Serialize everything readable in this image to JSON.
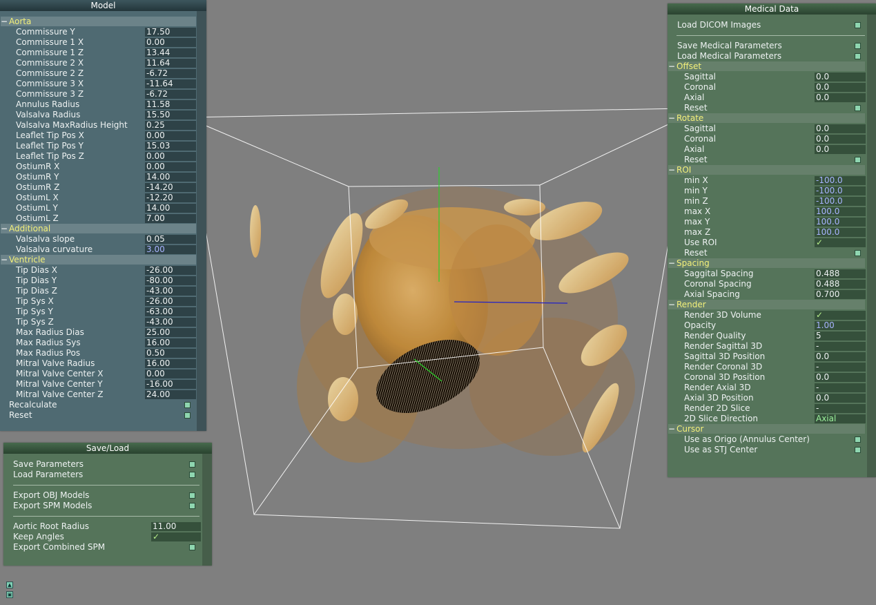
{
  "model": {
    "title": "Model",
    "sections": [
      {
        "name": "Aorta",
        "rows": [
          {
            "label": "Commissure Y",
            "value": "17.50"
          },
          {
            "label": "Commissure 1 X",
            "value": "0.00"
          },
          {
            "label": "Commissure 1 Z",
            "value": "13.44"
          },
          {
            "label": "Commissure 2 X",
            "value": "11.64"
          },
          {
            "label": "Commissure 2 Z",
            "value": "-6.72"
          },
          {
            "label": "Commissure 3 X",
            "value": "-11.64"
          },
          {
            "label": "Commissure 3 Z",
            "value": "-6.72"
          },
          {
            "label": "Annulus Radius",
            "value": "11.58"
          },
          {
            "label": "Valsalva Radius",
            "value": "15.50"
          },
          {
            "label": "Valsalva MaxRadius Height",
            "value": "0.25"
          },
          {
            "label": "Leaflet Tip Pos X",
            "value": "0.00"
          },
          {
            "label": "Leaflet Tip Pos Y",
            "value": "15.03"
          },
          {
            "label": "Leaflet Tip Pos Z",
            "value": "0.00"
          },
          {
            "label": "OstiumR X",
            "value": "0.00"
          },
          {
            "label": "OstiumR Y",
            "value": "14.00"
          },
          {
            "label": "OstiumR Z",
            "value": "-14.20"
          },
          {
            "label": "OstiumL X",
            "value": "-12.20"
          },
          {
            "label": "OstiumL Y",
            "value": "14.00"
          },
          {
            "label": "OstiumL Z",
            "value": "7.00"
          }
        ]
      },
      {
        "name": "Additional",
        "rows": [
          {
            "label": "Valsalva slope",
            "value": "0.05"
          },
          {
            "label": "Valsalva curvature",
            "value": "3.00",
            "style": "blue"
          }
        ]
      },
      {
        "name": "Ventricle",
        "rows": [
          {
            "label": "Tip Dias X",
            "value": "-26.00"
          },
          {
            "label": "Tip Dias Y",
            "value": "-80.00"
          },
          {
            "label": "Tip Dias Z",
            "value": "-43.00"
          },
          {
            "label": "Tip Sys X",
            "value": "-26.00"
          },
          {
            "label": "Tip Sys Y",
            "value": "-63.00"
          },
          {
            "label": "Tip Sys Z",
            "value": "-43.00"
          },
          {
            "label": "Max Radius Dias",
            "value": "25.00"
          },
          {
            "label": "Max Radius Sys",
            "value": "16.00"
          },
          {
            "label": "Max Radius Pos",
            "value": "0.50"
          },
          {
            "label": "Mitral Valve Radius",
            "value": "16.00"
          },
          {
            "label": "Mitral Valve Center X",
            "value": "0.00"
          },
          {
            "label": "Mitral Valve Center Y",
            "value": "-16.00"
          },
          {
            "label": "Mitral Valve Center Z",
            "value": "24.00"
          }
        ]
      }
    ],
    "buttons": [
      {
        "label": "Recalculate"
      },
      {
        "label": "Reset"
      }
    ]
  },
  "saveload": {
    "title": "Save/Load",
    "items": [
      {
        "kind": "button",
        "label": "Save Parameters"
      },
      {
        "kind": "button",
        "label": "Load Parameters"
      },
      {
        "kind": "sep"
      },
      {
        "kind": "button",
        "label": "Export OBJ Models"
      },
      {
        "kind": "button",
        "label": "Export SPM Models"
      },
      {
        "kind": "sep"
      },
      {
        "kind": "value",
        "label": "Aortic Root Radius",
        "value": "11.00"
      },
      {
        "kind": "value",
        "label": "Keep Angles",
        "value": "✓",
        "style": "check"
      },
      {
        "kind": "button",
        "label": "Export Combined SPM"
      }
    ]
  },
  "medical": {
    "title": "Medical Data",
    "top": [
      {
        "kind": "button",
        "label": "Load DICOM Images"
      },
      {
        "kind": "sep"
      },
      {
        "kind": "button",
        "label": "Save Medical Parameters"
      },
      {
        "kind": "button",
        "label": "Load Medical Parameters"
      }
    ],
    "sections": [
      {
        "name": "Offset",
        "rows": [
          {
            "label": "Sagittal",
            "value": "0.0"
          },
          {
            "label": "Coronal",
            "value": "0.0"
          },
          {
            "label": "Axial",
            "value": "0.0"
          },
          {
            "label": "Reset",
            "button": true
          }
        ]
      },
      {
        "name": "Rotate",
        "rows": [
          {
            "label": "Sagittal",
            "value": "0.0"
          },
          {
            "label": "Coronal",
            "value": "0.0"
          },
          {
            "label": "Axial",
            "value": "0.0"
          },
          {
            "label": "Reset",
            "button": true
          }
        ]
      },
      {
        "name": "ROI",
        "rows": [
          {
            "label": "min X",
            "value": "-100.0",
            "style": "blue"
          },
          {
            "label": "min Y",
            "value": "-100.0",
            "style": "blue"
          },
          {
            "label": "min Z",
            "value": "-100.0",
            "style": "blue"
          },
          {
            "label": "max X",
            "value": "100.0",
            "style": "blue"
          },
          {
            "label": "max Y",
            "value": "100.0",
            "style": "blue"
          },
          {
            "label": "max Z",
            "value": "100.0",
            "style": "blue"
          },
          {
            "label": "Use ROI",
            "value": "✓",
            "style": "check"
          },
          {
            "label": "Reset",
            "button": true
          }
        ]
      },
      {
        "name": "Spacing",
        "rows": [
          {
            "label": "Saggital Spacing",
            "value": "0.488"
          },
          {
            "label": "Coronal Spacing",
            "value": "0.488"
          },
          {
            "label": "Axial Spacing",
            "value": "0.700"
          }
        ]
      },
      {
        "name": "Render",
        "rows": [
          {
            "label": "Render 3D Volume",
            "value": "✓",
            "style": "check"
          },
          {
            "label": "Opacity",
            "value": "1.00",
            "style": "blue"
          },
          {
            "label": "Render Quality",
            "value": "5"
          },
          {
            "label": "Render Sagittal 3D",
            "value": "-"
          },
          {
            "label": "Sagittal 3D Position",
            "value": "0.0"
          },
          {
            "label": "Render Coronal 3D",
            "value": "-"
          },
          {
            "label": "Coronal 3D Position",
            "value": "0.0"
          },
          {
            "label": "Render Axial 3D",
            "value": "-"
          },
          {
            "label": "Axial 3D Position",
            "value": "0.0"
          },
          {
            "label": "Render 2D Slice",
            "value": "-"
          },
          {
            "label": "2D Slice Direction",
            "value": "Axial",
            "style": "green"
          }
        ]
      },
      {
        "name": "Cursor",
        "rows": [
          {
            "label": "Use as Origo (Annulus Center)",
            "button": true
          },
          {
            "label": "Use as STJ Center",
            "button": true
          }
        ]
      }
    ]
  },
  "colors": {
    "volume": "#d79a3c",
    "volume_light": "#f2c77a",
    "axis_green": "#2ad02a",
    "axis_blue": "#2020c8",
    "box": "#ffffff"
  },
  "icons": [
    "minimize-icon",
    "restore-icon"
  ]
}
